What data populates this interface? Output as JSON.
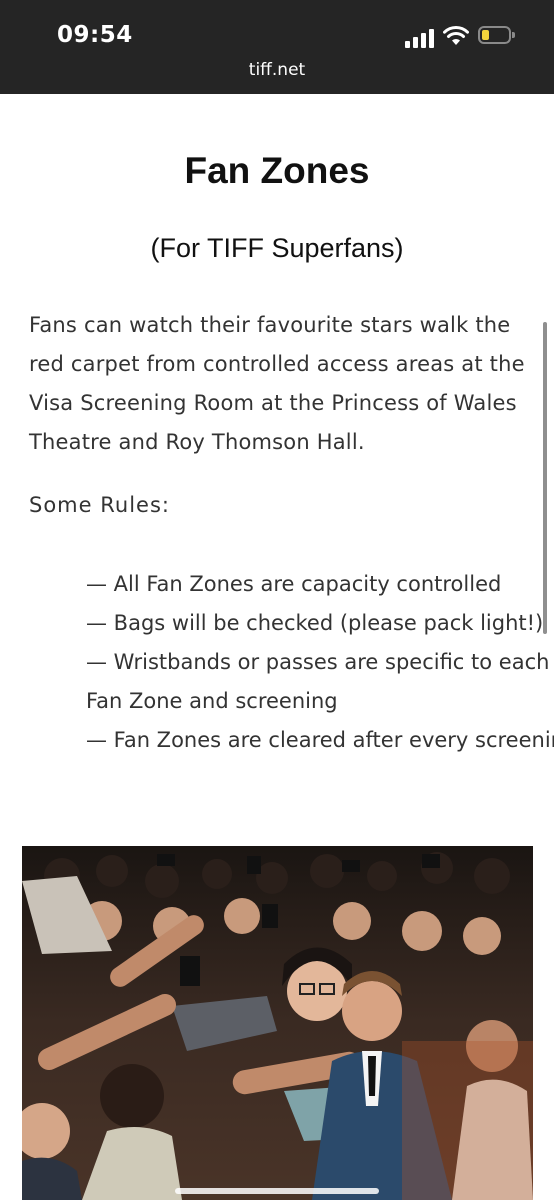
{
  "status_bar": {
    "time": "09:54",
    "url": "tiff.net",
    "battery_color": "#f2d43c"
  },
  "article": {
    "title": "Fan Zones",
    "subtitle": "(For TIFF Superfans)",
    "intro": "Fans can watch their favourite stars walk the red carpet from controlled access areas at the Visa Screening Room at the Princess of Wales Theatre and Roy Thomson Hall.",
    "rules_heading": "Some Rules:",
    "rules": [
      "— All Fan Zones are capacity controlled",
      "— Bags will be checked (please pack light!)",
      "— Wristbands or passes are specific to each Fan Zone and screening",
      "— Fan Zones are cleared after every screening"
    ]
  },
  "icons": {
    "signal": "cellular-signal-icon",
    "wifi": "wifi-icon",
    "battery": "battery-icon"
  }
}
